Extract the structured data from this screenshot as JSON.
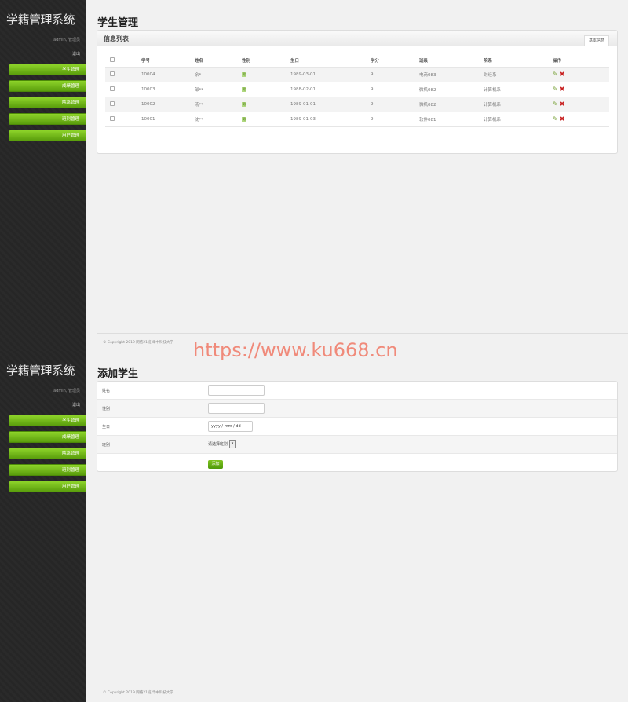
{
  "app": {
    "brand": "学籍管理系统",
    "user_line": "admin, 管理员",
    "logout": "退出",
    "nav": [
      "学生管理",
      "成绩管理",
      "院系管理",
      "班别管理",
      "用户管理"
    ]
  },
  "list_page": {
    "title": "学生管理",
    "panel_title": "信息列表",
    "panel_tab": "基本信息",
    "columns": [
      "",
      "学号",
      "姓名",
      "性别",
      "生日",
      "学分",
      "班级",
      "院系",
      "操作"
    ],
    "rows": [
      {
        "id": "10004",
        "name": "余*",
        "gender": "男",
        "birthday": "1989-03-01",
        "credit": "9",
        "class": "电商083",
        "dept": "财经系"
      },
      {
        "id": "10003",
        "name": "邹**",
        "gender": "男",
        "birthday": "1988-02-01",
        "credit": "9",
        "class": "微机082",
        "dept": "计算机系"
      },
      {
        "id": "10002",
        "name": "汤**",
        "gender": "男",
        "birthday": "1989-01-01",
        "credit": "9",
        "class": "微机082",
        "dept": "计算机系"
      },
      {
        "id": "10001",
        "name": "沈**",
        "gender": "男",
        "birthday": "1989-01-03",
        "credit": "9",
        "class": "软件081",
        "dept": "计算机系"
      }
    ],
    "footer": "© Copyright 2019 网络21班 华中科技大学"
  },
  "form_page": {
    "title": "添加学生",
    "fields": {
      "name_label": "姓名",
      "gender_label": "性别",
      "birthday_label": "生日",
      "class_label": "班别"
    },
    "date_placeholder": "yyyy / mm / dd",
    "class_select": "请选择班别",
    "submit": "添加",
    "footer": "© Copyright 2019 网络21班 华中科技大学"
  },
  "watermark": "https://www.ku668.cn",
  "colors": {
    "accent": "#6aae14",
    "sidebar": "#2a2a2a",
    "delete": "#c82020"
  }
}
